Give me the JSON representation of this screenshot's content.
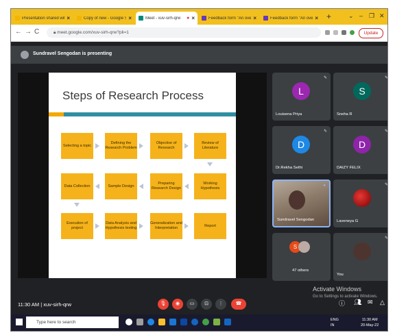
{
  "browser": {
    "tabs": [
      {
        "label": "Presentation shared with yo",
        "icon_color": "#f4b400",
        "active": false
      },
      {
        "label": "Copy of new - Google Slides",
        "icon_color": "#f4b400",
        "active": false
      },
      {
        "label": "Meet - xuv-sirh-qrw",
        "icon_color": "#00897b",
        "active": true
      },
      {
        "label": "Feedback form \"An overvie",
        "icon_color": "#673ab7",
        "active": false
      },
      {
        "label": "Feedback form \"An overvie",
        "icon_color": "#673ab7",
        "active": false
      }
    ],
    "new_tab": "+",
    "url": "meet.google.com/xuv-sirh-qrw?pli=1",
    "update_label": "Update"
  },
  "meet": {
    "presenting_text": "Sundravel Sengodan is presenting",
    "meeting_code_line": "11:30 AM | xuv-sirh-qrw",
    "participants": [
      {
        "name": "Louisena Priya",
        "initial": "L",
        "color": "#9c27b0"
      },
      {
        "name": "Sneha R",
        "initial": "S",
        "color": "#00695c"
      },
      {
        "name": "Dr.Rekha Sethi",
        "initial": "D",
        "color": "#1e88e5"
      },
      {
        "name": "DAIZY FELIX",
        "initial": "D",
        "color": "#8e24aa"
      },
      {
        "name": "Sundravel Sengodan",
        "initial": "",
        "color": "#6d4c41"
      },
      {
        "name": "Laveneya G",
        "initial": "",
        "color": "#b71c1c"
      },
      {
        "name": "47 others",
        "initial": "S",
        "color": "#e64a19"
      },
      {
        "name": "You",
        "initial": "",
        "color": "#4e342e"
      }
    ],
    "watermark_title": "Activate Windows",
    "watermark_sub": "Go to Settings to activate Windows."
  },
  "slide": {
    "title": "Steps of Research Process",
    "steps": [
      "Selecting a topic",
      "Defining the Research Problem",
      "Objective of Research",
      "Review of Literature",
      "Data Collection",
      "Sample Design",
      "Preparing Research Design",
      "Working Hypothesis",
      "Execution of project",
      "Data Analysis and Hypothesis testing",
      "Generalization and Interpretation",
      "Report"
    ]
  },
  "taskbar": {
    "search_placeholder": "Type here to search",
    "lang": "ENG",
    "region": "IN",
    "time": "11:30 AM",
    "date": "20-May-22"
  },
  "colors": {
    "step_fill": "#f5b21a",
    "slide_bar": "#2f8ea2",
    "end_call": "#ea4335"
  }
}
